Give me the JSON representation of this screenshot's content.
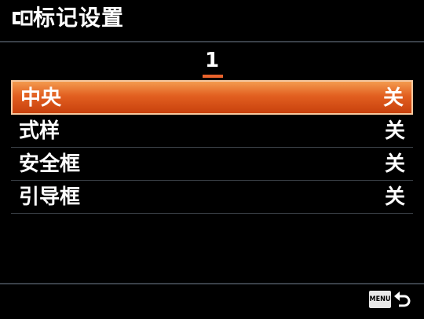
{
  "header": {
    "title": "标记设置",
    "icon": "marker-frame-icon"
  },
  "page": {
    "number": "1",
    "accent_color": "#e8622c"
  },
  "menu": {
    "items": [
      {
        "label": "中央",
        "value": "关",
        "selected": true
      },
      {
        "label": "式样",
        "value": "关",
        "selected": false
      },
      {
        "label": "安全框",
        "value": "关",
        "selected": false
      },
      {
        "label": "引导框",
        "value": "关",
        "selected": false
      }
    ],
    "selected_color": "#e25f20"
  },
  "footer": {
    "menu_button_label": "MENU",
    "back_icon": "return-arrow-icon"
  }
}
